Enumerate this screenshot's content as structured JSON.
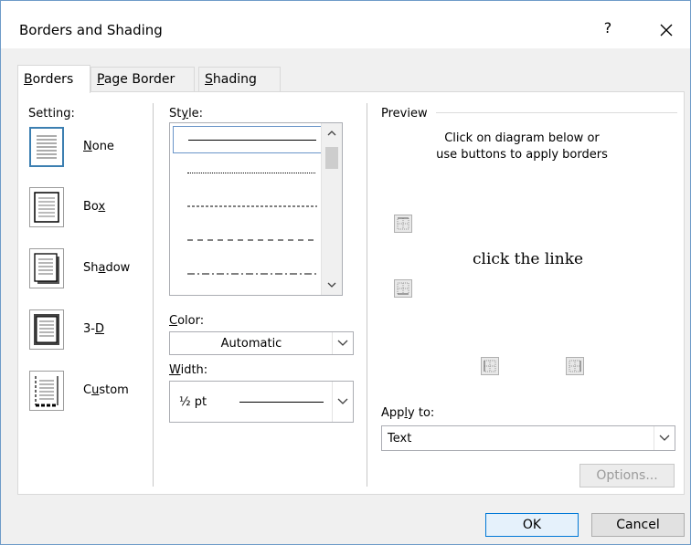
{
  "window": {
    "title": "Borders and Shading",
    "help_label": "?",
    "close_label": "×"
  },
  "tabs": [
    {
      "label": "Borders",
      "access_key": "B"
    },
    {
      "label": "Page Border",
      "access_key": "P"
    },
    {
      "label": "Shading",
      "access_key": "S"
    }
  ],
  "setting": {
    "heading": "Setting:",
    "items": [
      {
        "label": "None",
        "selected": true
      },
      {
        "label": "Box"
      },
      {
        "label": "Shadow"
      },
      {
        "label": "3-D"
      },
      {
        "label": "Custom"
      }
    ]
  },
  "style": {
    "heading": "Style:",
    "options": [
      "solid",
      "dotted",
      "dashed-short",
      "dashed",
      "dash-dot"
    ],
    "selected": "solid"
  },
  "color": {
    "heading": "Color:",
    "value": "Automatic"
  },
  "width": {
    "heading": "Width:",
    "value": "½ pt"
  },
  "preview": {
    "heading": "Preview",
    "instruction_line1": "Click on diagram below or",
    "instruction_line2": "use buttons to apply borders",
    "sample_text": "click the linke"
  },
  "apply_to": {
    "heading": "Apply to:",
    "value": "Text"
  },
  "buttons": {
    "options": "Options...",
    "ok": "OK",
    "cancel": "Cancel"
  },
  "colors": {
    "accent": "#0078d7",
    "selected_border": "#3c7fb1"
  }
}
